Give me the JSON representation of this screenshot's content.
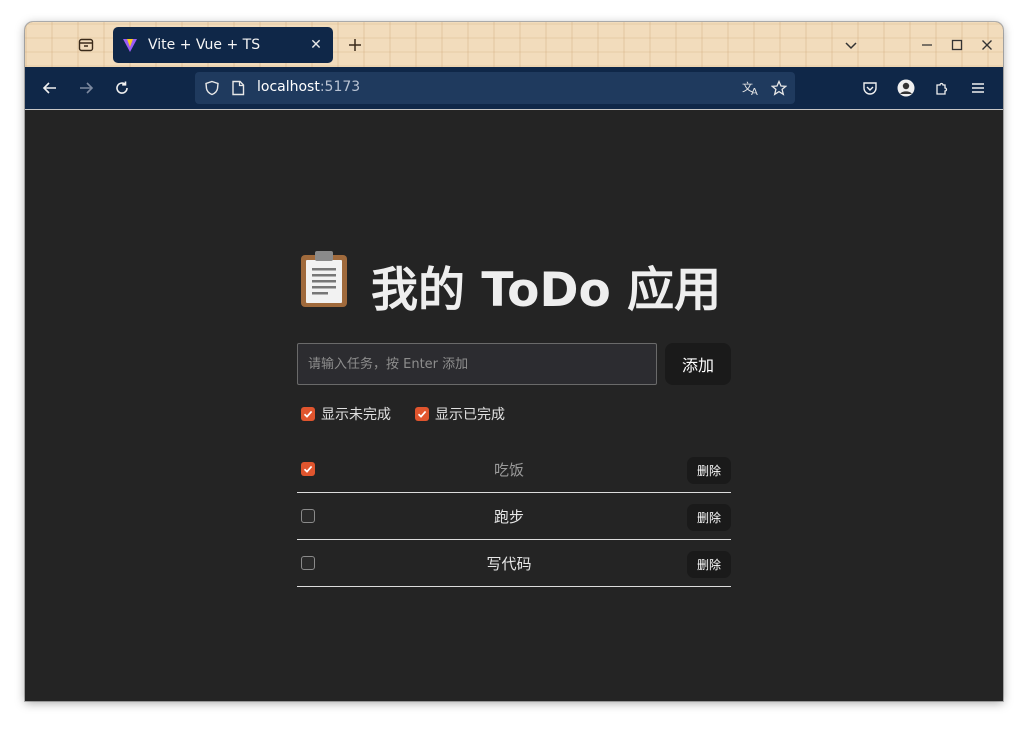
{
  "browser": {
    "tab": {
      "title": "Vite + Vue + TS",
      "favicon": "vite-logo-icon"
    },
    "urlbar": {
      "host": "localhost",
      "port": ":5173"
    }
  },
  "app": {
    "heading_emoji": "clipboard-icon",
    "heading": "我的 ToDo 应用",
    "input": {
      "placeholder": "请输入任务，按 Enter 添加",
      "value": ""
    },
    "add_label": "添加",
    "filters": [
      {
        "label": "显示未完成",
        "checked": true
      },
      {
        "label": "显示已完成",
        "checked": true
      }
    ],
    "todos": [
      {
        "text": "吃饭",
        "done": true,
        "delete_label": "删除"
      },
      {
        "text": "跑步",
        "done": false,
        "delete_label": "删除"
      },
      {
        "text": "写代码",
        "done": false,
        "delete_label": "删除"
      }
    ]
  },
  "colors": {
    "accent": "#e0552e",
    "page_bg": "#242424",
    "toolbar_bg": "#0f2748",
    "tabstrip_bg": "#f2dcbc"
  }
}
